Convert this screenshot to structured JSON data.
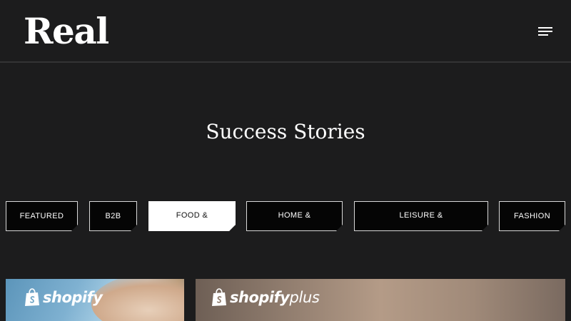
{
  "header": {
    "logo": "Real",
    "menu_icon": "hamburger-menu-icon"
  },
  "main": {
    "title": "Success Stories",
    "tabs": [
      {
        "label": "FEATURED",
        "active": false
      },
      {
        "label": "B2B",
        "active": false
      },
      {
        "label": "FOOD &",
        "active": true
      },
      {
        "label": "HOME &",
        "active": false
      },
      {
        "label": "LEISURE &",
        "active": false
      },
      {
        "label": "FASHION",
        "active": false
      }
    ],
    "cards": [
      {
        "brand": "shopify",
        "brand_suffix": "",
        "icon": "shopify-bag-icon"
      },
      {
        "brand": "shopify",
        "brand_suffix": "plus",
        "icon": "shopify-bag-icon"
      }
    ]
  },
  "colors": {
    "background": "#1c1c1d",
    "text": "#ffffff",
    "active_tab_bg": "#ffffff",
    "tab_bg": "#050505"
  }
}
